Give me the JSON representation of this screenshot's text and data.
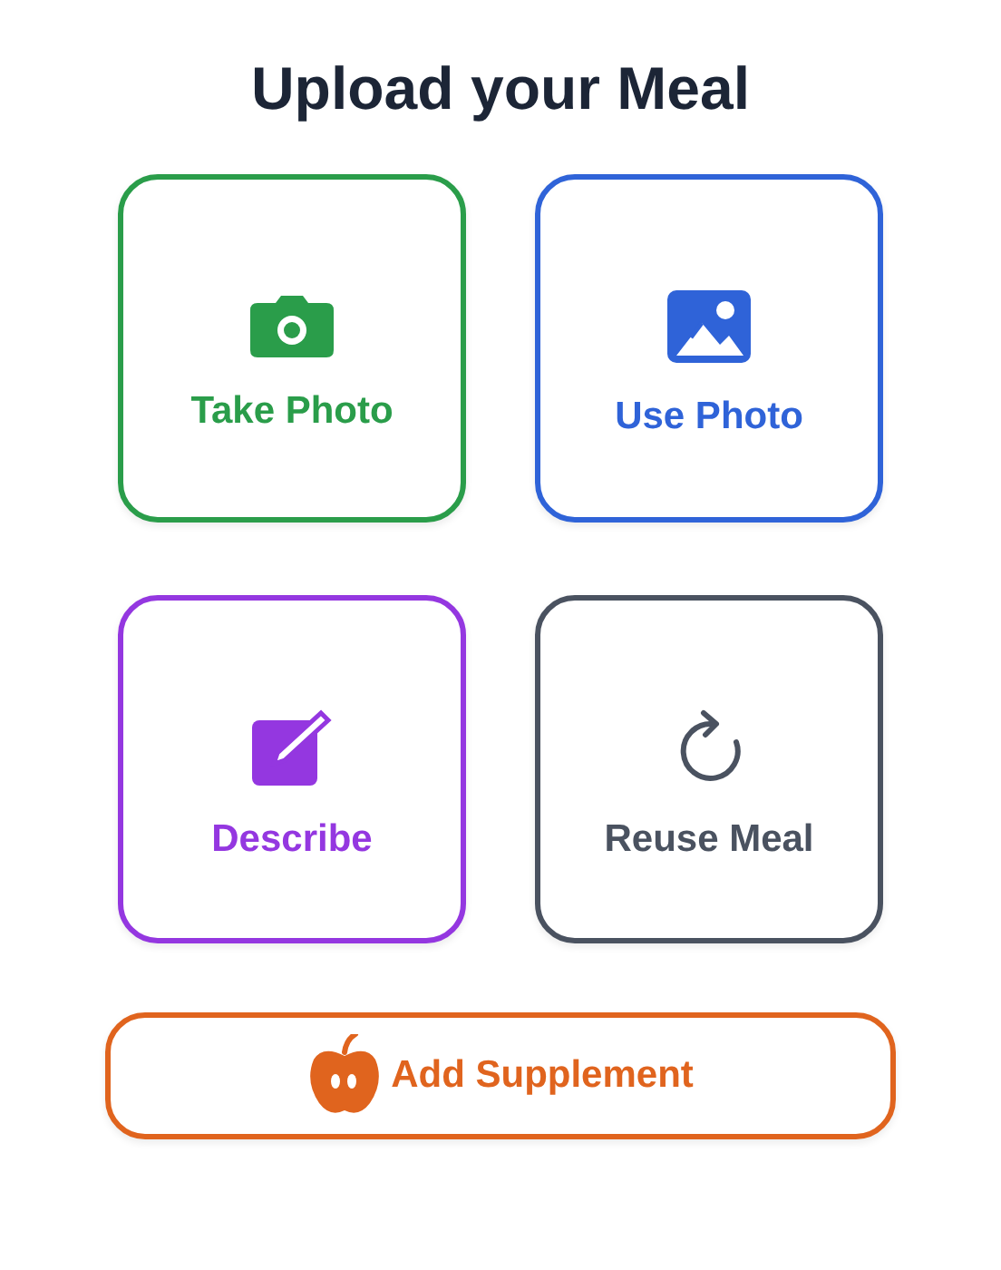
{
  "title": "Upload your Meal",
  "options": [
    {
      "label": "Take Photo",
      "kind": "camera",
      "color": "#2a9d4a"
    },
    {
      "label": "Use Photo",
      "kind": "image",
      "color": "#2f63d8"
    },
    {
      "label": "Describe",
      "kind": "edit",
      "color": "#9437e0"
    },
    {
      "label": "Reuse Meal",
      "kind": "refresh",
      "color": "#4a5260"
    }
  ],
  "supplement_button": {
    "label": "Add Supplement",
    "kind": "apple",
    "color": "#e0641e"
  }
}
